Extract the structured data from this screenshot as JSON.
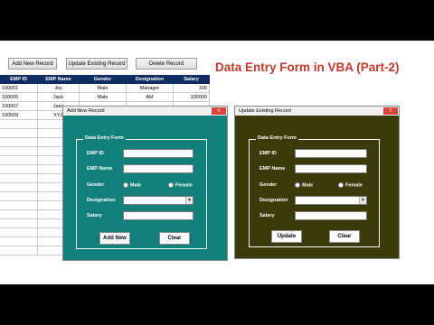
{
  "toolbar": {
    "add_label": "Add New Record",
    "update_label": "Update Existing Record",
    "delete_label": "Delete Record"
  },
  "title": "Data Entry Form in VBA (Part-2)",
  "table": {
    "headers": [
      "EMP ID",
      "EMP Name",
      "Gender",
      "Designation",
      "Salary"
    ],
    "rows": [
      [
        "100001",
        "Joy",
        "Male",
        "Manager",
        "100"
      ],
      [
        "100005",
        "Jack",
        "Male",
        "AM",
        "100000"
      ],
      [
        "100007",
        "Jaso",
        "",
        "",
        ""
      ],
      [
        "100009",
        "XYZ",
        "",
        "",
        ""
      ]
    ]
  },
  "add_form": {
    "window_title": "Add New Record",
    "close_glyph": "x",
    "frame_label": "Data Entry Form",
    "labels": {
      "emp_id": "EMP ID",
      "emp_name": "EMP Name",
      "gender": "Gender",
      "designation": "Designation",
      "salary": "Salary"
    },
    "gender_options": [
      "Male",
      "Female"
    ],
    "add_button": "Add New",
    "clear_button": "Clear"
  },
  "update_form": {
    "window_title": "Update Existing Record",
    "close_glyph": "x",
    "frame_label": "Data Entry Form",
    "labels": {
      "emp_id": "EMP ID",
      "emp_name": "EMP Name",
      "gender": "Gender",
      "designation": "Designation",
      "salary": "Salary"
    },
    "gender_options": [
      "Male",
      "Female"
    ],
    "update_button": "Update",
    "clear_button": "Clear"
  },
  "colors": {
    "add_form_bg": "#12807a",
    "update_form_bg": "#3b3a08",
    "table_header_bg": "#0f2d63",
    "title_color": "#c0392b"
  }
}
